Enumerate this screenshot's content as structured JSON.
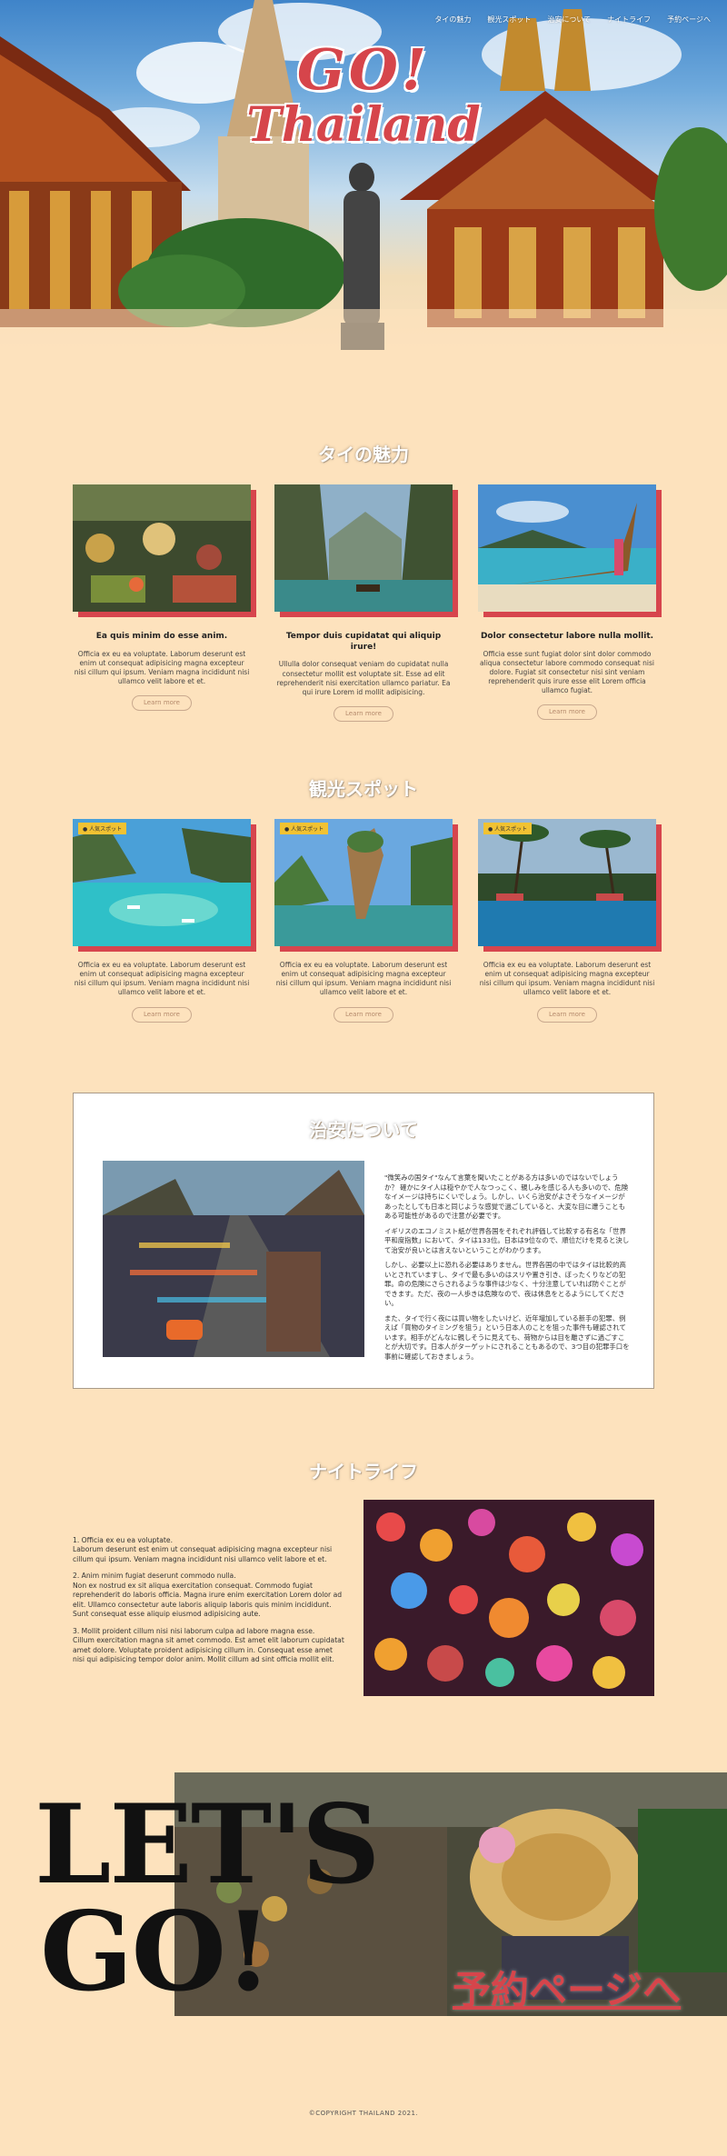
{
  "nav": {
    "items": [
      "タイの魅力",
      "観光スポット",
      "治安について",
      "ナイトライフ",
      "予約ページへ"
    ]
  },
  "hero": {
    "title_line1": "GO!",
    "title_line2": "Thailand"
  },
  "charm": {
    "title": "タイの魅力",
    "cards": [
      {
        "title": "Ea quis minim do esse anim.",
        "text": "Officia ex eu ea voluptate. Laborum deserunt est enim ut consequat adipisicing magna excepteur nisi cillum qui ipsum. Veniam magna incididunt nisi ullamco velit labore et et.",
        "button": "Learn more"
      },
      {
        "title": "Tempor duis cupidatat qui aliquip irure!",
        "text": "Ullulla dolor consequat veniam do cupidatat nulla consectetur mollit est voluptate sit. Esse ad elit reprehenderit nisi exercitation ullamco pariatur. Ea qui irure Lorem id mollit adipisicing.",
        "button": "Learn more"
      },
      {
        "title": "Dolor consectetur labore nulla mollit.",
        "text": "Officia esse sunt fugiat dolor sint dolor commodo aliqua consectetur labore commodo consequat nisi dolore. Fugiat sit consectetur nisi sint veniam reprehenderit quis irure esse elit Lorem officia ullamco fugiat.",
        "button": "Learn more"
      }
    ]
  },
  "spots": {
    "title": "観光スポット",
    "badge": "人気スポット",
    "cards": [
      {
        "text": "Officia ex eu ea voluptate. Laborum deserunt est enim ut consequat adipisicing magna excepteur nisi cillum qui ipsum. Veniam magna incididunt nisi ullamco velit labore et et.",
        "button": "Learn more"
      },
      {
        "text": "Officia ex eu ea voluptate. Laborum deserunt est enim ut consequat adipisicing magna excepteur nisi cillum qui ipsum. Veniam magna incididunt nisi ullamco velit labore et et.",
        "button": "Learn more"
      },
      {
        "text": "Officia ex eu ea voluptate. Laborum deserunt est enim ut consequat adipisicing magna excepteur nisi cillum qui ipsum. Veniam magna incididunt nisi ullamco velit labore et et.",
        "button": "Learn more"
      }
    ]
  },
  "safety": {
    "title": "治安について",
    "paragraphs": [
      "\"微笑みの国タイ\"なんて言葉を聞いたことがある方は多いのではないでしょうか？ 確かにタイ人は穏やかで人なつっこく、親しみを感じる人も多いので、危険なイメージは持ちにくいでしょう。しかし、いくら治安がよさそうなイメージがあったとしても日本と同じような感覚で過ごしていると、大変な目に遭うこともある可能性があるので注意が必要です。",
      "イギリスのエコノミスト紙が世界各国をそれぞれ評価して比較する有名な「世界平和度指数」において、タイは133位。日本は9位なので、順位だけを見ると決して治安が良いとは言えないということがわかります。",
      "しかし、必要以上に恐れる必要はありません。世界各国の中ではタイは比較的高いとされていますし、タイで最も多いのはスリや置き引き、ぼったくりなどの犯罪。命の危険にさらされるような事件は少なく、十分注意していれば防ぐことができます。ただ、夜の一人歩きは危険なので、夜は休息をとるようにしてください。",
      "また、タイで行く夜には買い物をしたいけど、近年増加している新手の犯罪、例えば「買物のタイミングを狙う」という日本人のことを狙った事件も確認されています。相手がどんなに親しそうに見えても、荷物からは目を離さずに過ごすことが大切です。日本人がターゲットにされることもあるので、3つ目の犯罪手口を事前に確認しておきましょう。"
    ]
  },
  "nightlife": {
    "title": "ナイトライフ",
    "items": [
      "1. Officia ex eu ea voluptate.\nLaborum deserunt est enim ut consequat adipisicing magna excepteur nisi cillum qui ipsum. Veniam magna incididunt nisi ullamco velit labore et et.",
      "2. Anim minim fugiat deserunt commodo nulla.\nNon ex nostrud ex sit aliqua exercitation consequat. Commodo fugiat reprehenderit do laboris officia. Magna irure enim exercitation Lorem dolor ad elit. Ullamco consectetur aute laboris aliquip laboris quis minim incididunt. Sunt consequat esse aliquip eiusmod adipisicing aute.",
      "3. Mollit proident cillum nisi nisi laborum culpa ad labore magna esse.\nCillum exercitation magna sit amet commodo. Est amet elit laborum cupidatat amet dolore. Voluptate proident adipisicing cillum in. Consequat esse amet nisi qui adipisicing tempor dolor anim. Mollit cillum ad sint officia mollit elit."
    ]
  },
  "cta": {
    "line1": "LET'S",
    "line2": "GO!",
    "link": "予約ページへ"
  },
  "footer": {
    "copyright": "©COPYRIGHT THAILAND 2021."
  },
  "colors": {
    "background": "#fde2bd",
    "accent_red": "#d7454d",
    "badge_yellow": "#f1c232"
  }
}
